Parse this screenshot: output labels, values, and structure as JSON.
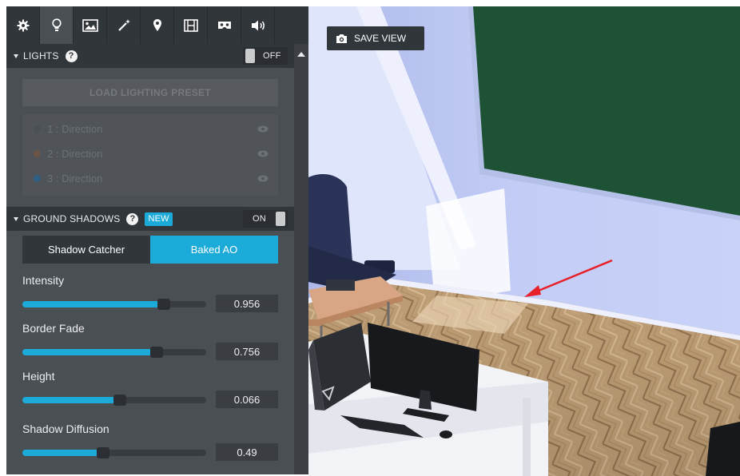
{
  "toolbar": {
    "tools": [
      {
        "icon": "gear-icon"
      },
      {
        "icon": "lightbulb-icon"
      },
      {
        "icon": "image-icon"
      },
      {
        "icon": "magic-wand-icon"
      },
      {
        "icon": "map-pin-icon"
      },
      {
        "icon": "film-icon"
      },
      {
        "icon": "vr-headset-icon"
      },
      {
        "icon": "speaker-icon"
      }
    ],
    "active_index": 1
  },
  "lights": {
    "header_label": "LIGHTS",
    "toggle_label": "OFF",
    "enabled": false,
    "preset_button": "LOAD LIGHTING PRESET",
    "items": [
      {
        "label": "1 : Direction",
        "color": "#4a4f53"
      },
      {
        "label": "2 : Direction",
        "color": "#6b5445"
      },
      {
        "label": "3 : Direction",
        "color": "#2f5f82"
      }
    ]
  },
  "ground_shadows": {
    "header_label": "GROUND SHADOWS",
    "badge": "NEW",
    "toggle_label": "ON",
    "enabled": true,
    "tabs": [
      {
        "label": "Shadow Catcher",
        "selected": false
      },
      {
        "label": "Baked AO",
        "selected": true
      }
    ],
    "sliders": [
      {
        "label": "Intensity",
        "value": "0.956",
        "fraction": 0.77
      },
      {
        "label": "Border Fade",
        "value": "0.756",
        "fraction": 0.73
      },
      {
        "label": "Height",
        "value": "0.066",
        "fraction": 0.53
      },
      {
        "label": "Shadow Diffusion",
        "value": "0.49",
        "fraction": 0.44
      }
    ]
  },
  "viewport": {
    "save_view_label": "SAVE VIEW"
  },
  "colors": {
    "accent": "#1caad9",
    "panel_bg": "#4a4f54",
    "header_bg": "#31363b",
    "annotation_arrow": "#e8202a"
  }
}
